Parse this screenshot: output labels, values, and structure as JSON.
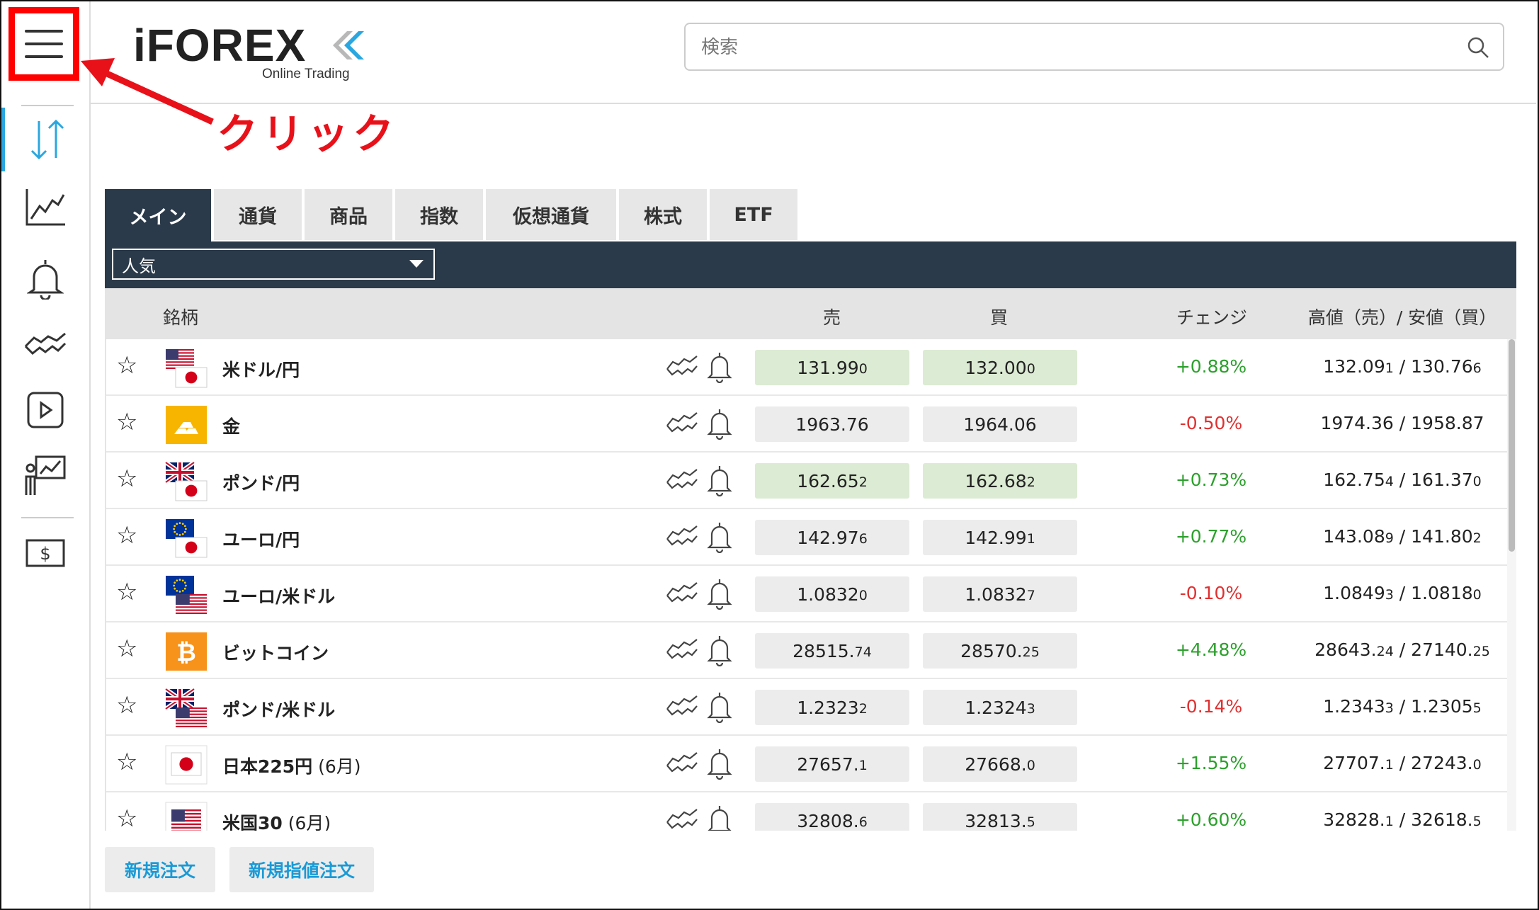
{
  "brand": {
    "logo_text": "iFOREX",
    "logo_subtitle": "Online Trading"
  },
  "search": {
    "placeholder": "検索"
  },
  "annotation": {
    "label": "クリック",
    "color": "#e8111a"
  },
  "sidebar": {
    "items": [
      {
        "icon": "trade-arrows-icon",
        "active": true
      },
      {
        "icon": "chart-icon"
      },
      {
        "icon": "bell-icon"
      },
      {
        "icon": "handshake-icon"
      },
      {
        "icon": "video-icon"
      },
      {
        "icon": "presenter-chart-icon"
      },
      {
        "icon": "dollar-bill-icon"
      }
    ]
  },
  "tabs": [
    "メイン",
    "通貨",
    "商品",
    "指数",
    "仮想通貨",
    "株式",
    "ETF"
  ],
  "filter": {
    "selected": "人気"
  },
  "table": {
    "headers": {
      "symbol": "銘柄",
      "sell": "売",
      "buy": "買",
      "change": "チェンジ",
      "hilo": "高値（売）/ 安値（買）"
    },
    "rows": [
      {
        "name": "米ドル/円",
        "suffix": "",
        "flag": "us-jp",
        "sell_main": "131.99",
        "sell_small": "0",
        "buy_main": "132.00",
        "buy_small": "0",
        "highlight": true,
        "change": "+0.88%",
        "high_main": "132.09",
        "high_small": "1",
        "low_main": "130.76",
        "low_small": "6"
      },
      {
        "name": "金",
        "suffix": "",
        "flag": "gold",
        "sell_main": "1963.76",
        "sell_small": "",
        "buy_main": "1964.06",
        "buy_small": "",
        "highlight": false,
        "change": "-0.50%",
        "high_main": "1974.36",
        "high_small": "",
        "low_main": "1958.87",
        "low_small": ""
      },
      {
        "name": "ポンド/円",
        "suffix": "",
        "flag": "gb-jp",
        "sell_main": "162.65",
        "sell_small": "2",
        "buy_main": "162.68",
        "buy_small": "2",
        "highlight": true,
        "change": "+0.73%",
        "high_main": "162.75",
        "high_small": "4",
        "low_main": "161.37",
        "low_small": "0"
      },
      {
        "name": "ユーロ/円",
        "suffix": "",
        "flag": "eu-jp",
        "sell_main": "142.97",
        "sell_small": "6",
        "buy_main": "142.99",
        "buy_small": "1",
        "highlight": false,
        "change": "+0.77%",
        "high_main": "143.08",
        "high_small": "9",
        "low_main": "141.80",
        "low_small": "2"
      },
      {
        "name": "ユーロ/米ドル",
        "suffix": "",
        "flag": "eu-us",
        "sell_main": "1.0832",
        "sell_small": "0",
        "buy_main": "1.0832",
        "buy_small": "7",
        "highlight": false,
        "change": "-0.10%",
        "high_main": "1.0849",
        "high_small": "3",
        "low_main": "1.0818",
        "low_small": "0"
      },
      {
        "name": "ビットコイン",
        "suffix": "",
        "flag": "btc",
        "sell_main": "28515.",
        "sell_small": "74",
        "buy_main": "28570.",
        "buy_small": "25",
        "highlight": false,
        "change": "+4.48%",
        "high_main": "28643.",
        "high_small": "24",
        "low_main": "27140.",
        "low_small": "25"
      },
      {
        "name": "ポンド/米ドル",
        "suffix": "",
        "flag": "gb-us",
        "sell_main": "1.2323",
        "sell_small": "2",
        "buy_main": "1.2324",
        "buy_small": "3",
        "highlight": false,
        "change": "-0.14%",
        "high_main": "1.2343",
        "high_small": "3",
        "low_main": "1.2305",
        "low_small": "5"
      },
      {
        "name": "日本225円",
        "suffix": " (6月)",
        "flag": "jp",
        "sell_main": "27657.",
        "sell_small": "1",
        "buy_main": "27668.",
        "buy_small": "0",
        "highlight": false,
        "change": "+1.55%",
        "high_main": "27707.",
        "high_small": "1",
        "low_main": "27243.",
        "low_small": "0"
      },
      {
        "name": "米国30",
        "suffix": " (6月)",
        "flag": "us",
        "sell_main": "32808.",
        "sell_small": "6",
        "buy_main": "32813.",
        "buy_small": "5",
        "highlight": false,
        "change": "+0.60%",
        "high_main": "32828.",
        "high_small": "1",
        "low_main": "32618.",
        "low_small": "5"
      }
    ]
  },
  "buttons": {
    "new_order": "新規注文",
    "new_limit_order": "新規指値注文"
  },
  "colors": {
    "navy": "#2b3a4a",
    "accent": "#2aa7e0",
    "up_green": "#2ca02c",
    "down_red": "#e03030",
    "highlight_bg": "#dcebd3"
  }
}
